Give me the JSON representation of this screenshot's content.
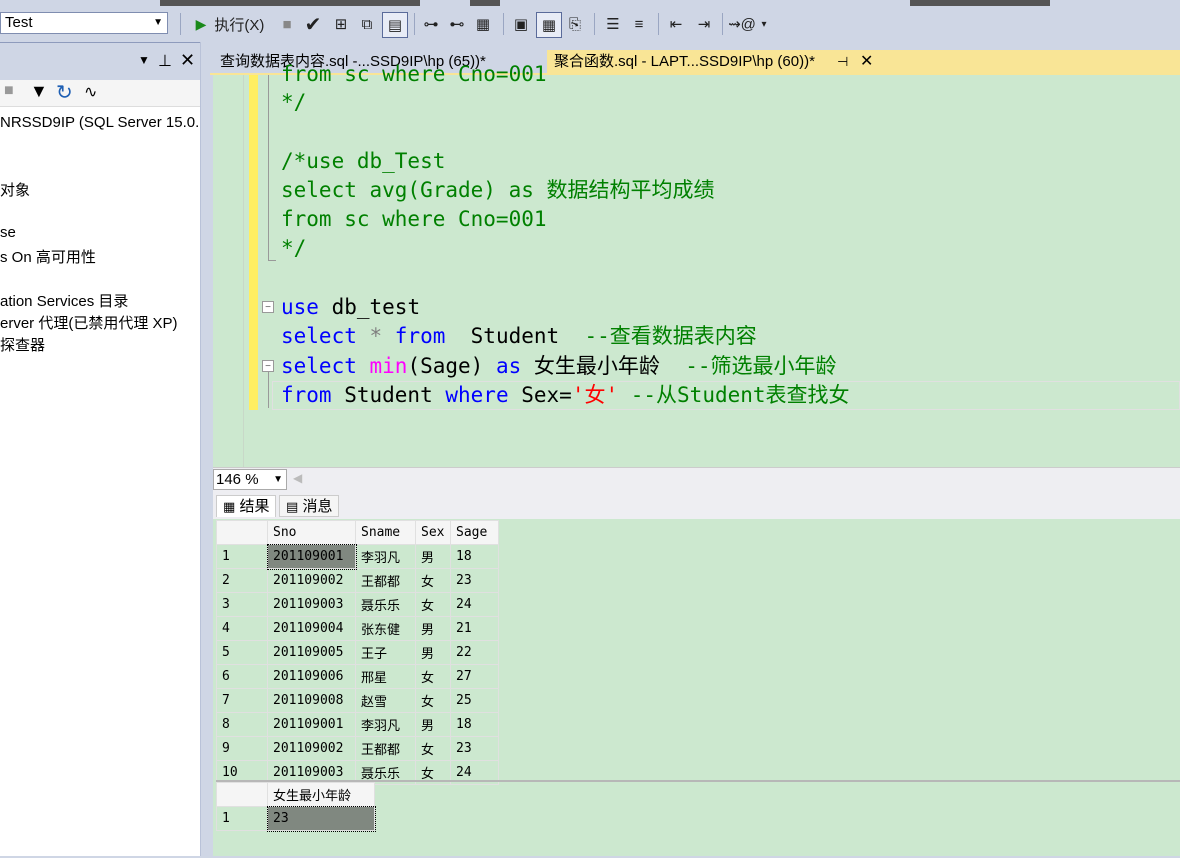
{
  "toolbar": {
    "database": "Test",
    "execute_label": "执行(X)"
  },
  "tree": [
    "NRSSD9IP (SQL Server 15.0.2",
    "对象",
    "se",
    "s On 高可用性",
    "ation Services 目录",
    "erver 代理(已禁用代理 XP)",
    "探查器"
  ],
  "tabs": [
    {
      "label": "查询数据表内容.sql -...SSD9IP\\hp (65))*"
    },
    {
      "label": "聚合函数.sql - LAPT...SSD9IP\\hp (60))*"
    }
  ],
  "code": {
    "l0": "from sc where Cno=001",
    "l1": "*/",
    "l2": "/*use db_Test",
    "l3": "select avg(Grade) as 数据结构平均成绩",
    "l4": "from sc where Cno=001",
    "l5": "*/",
    "l6_kw": "use",
    "l6_rest": " db_test",
    "l7_kw": "select",
    "l7_star": " * ",
    "l7_kw2": "from",
    "l7_rest": "  Student  ",
    "l7_cm": "--查看数据表内容",
    "l8_kw": "select",
    "l8_fn": "min",
    "l8_rest": "(Sage) ",
    "l8_kw2": "as",
    "l8_alias": " 女生最小年龄  ",
    "l8_cm": "--筛选最小年龄",
    "l9_kw": "from",
    "l9_rest": " Student ",
    "l9_kw2": "where",
    "l9_rest2": " Sex=",
    "l9_str": "'女'",
    "l9_cm": " --从Student表查找女"
  },
  "zoom": "146 %",
  "result_tabs": {
    "results": "结果",
    "messages": "消息"
  },
  "grid1": {
    "columns": [
      "Sno",
      "Sname",
      "Sex",
      "Sage"
    ],
    "rows": [
      [
        "1",
        "201109001",
        "李羽凡",
        "男",
        "18"
      ],
      [
        "2",
        "201109002",
        "王都都",
        "女",
        "23"
      ],
      [
        "3",
        "201109003",
        "聂乐乐",
        "女",
        "24"
      ],
      [
        "4",
        "201109004",
        "张东健",
        "男",
        "21"
      ],
      [
        "5",
        "201109005",
        "王子",
        "男",
        "22"
      ],
      [
        "6",
        "201109006",
        "邢星",
        "女",
        "27"
      ],
      [
        "7",
        "201109008",
        "赵雪",
        "女",
        "25"
      ],
      [
        "8",
        "201109001",
        "李羽凡",
        "男",
        "18"
      ],
      [
        "9",
        "201109002",
        "王都都",
        "女",
        "23"
      ],
      [
        "10",
        "201109003",
        "聂乐乐",
        "女",
        "24"
      ]
    ]
  },
  "grid2": {
    "column": "女生最小年龄",
    "row_num": "1",
    "value": "23"
  }
}
